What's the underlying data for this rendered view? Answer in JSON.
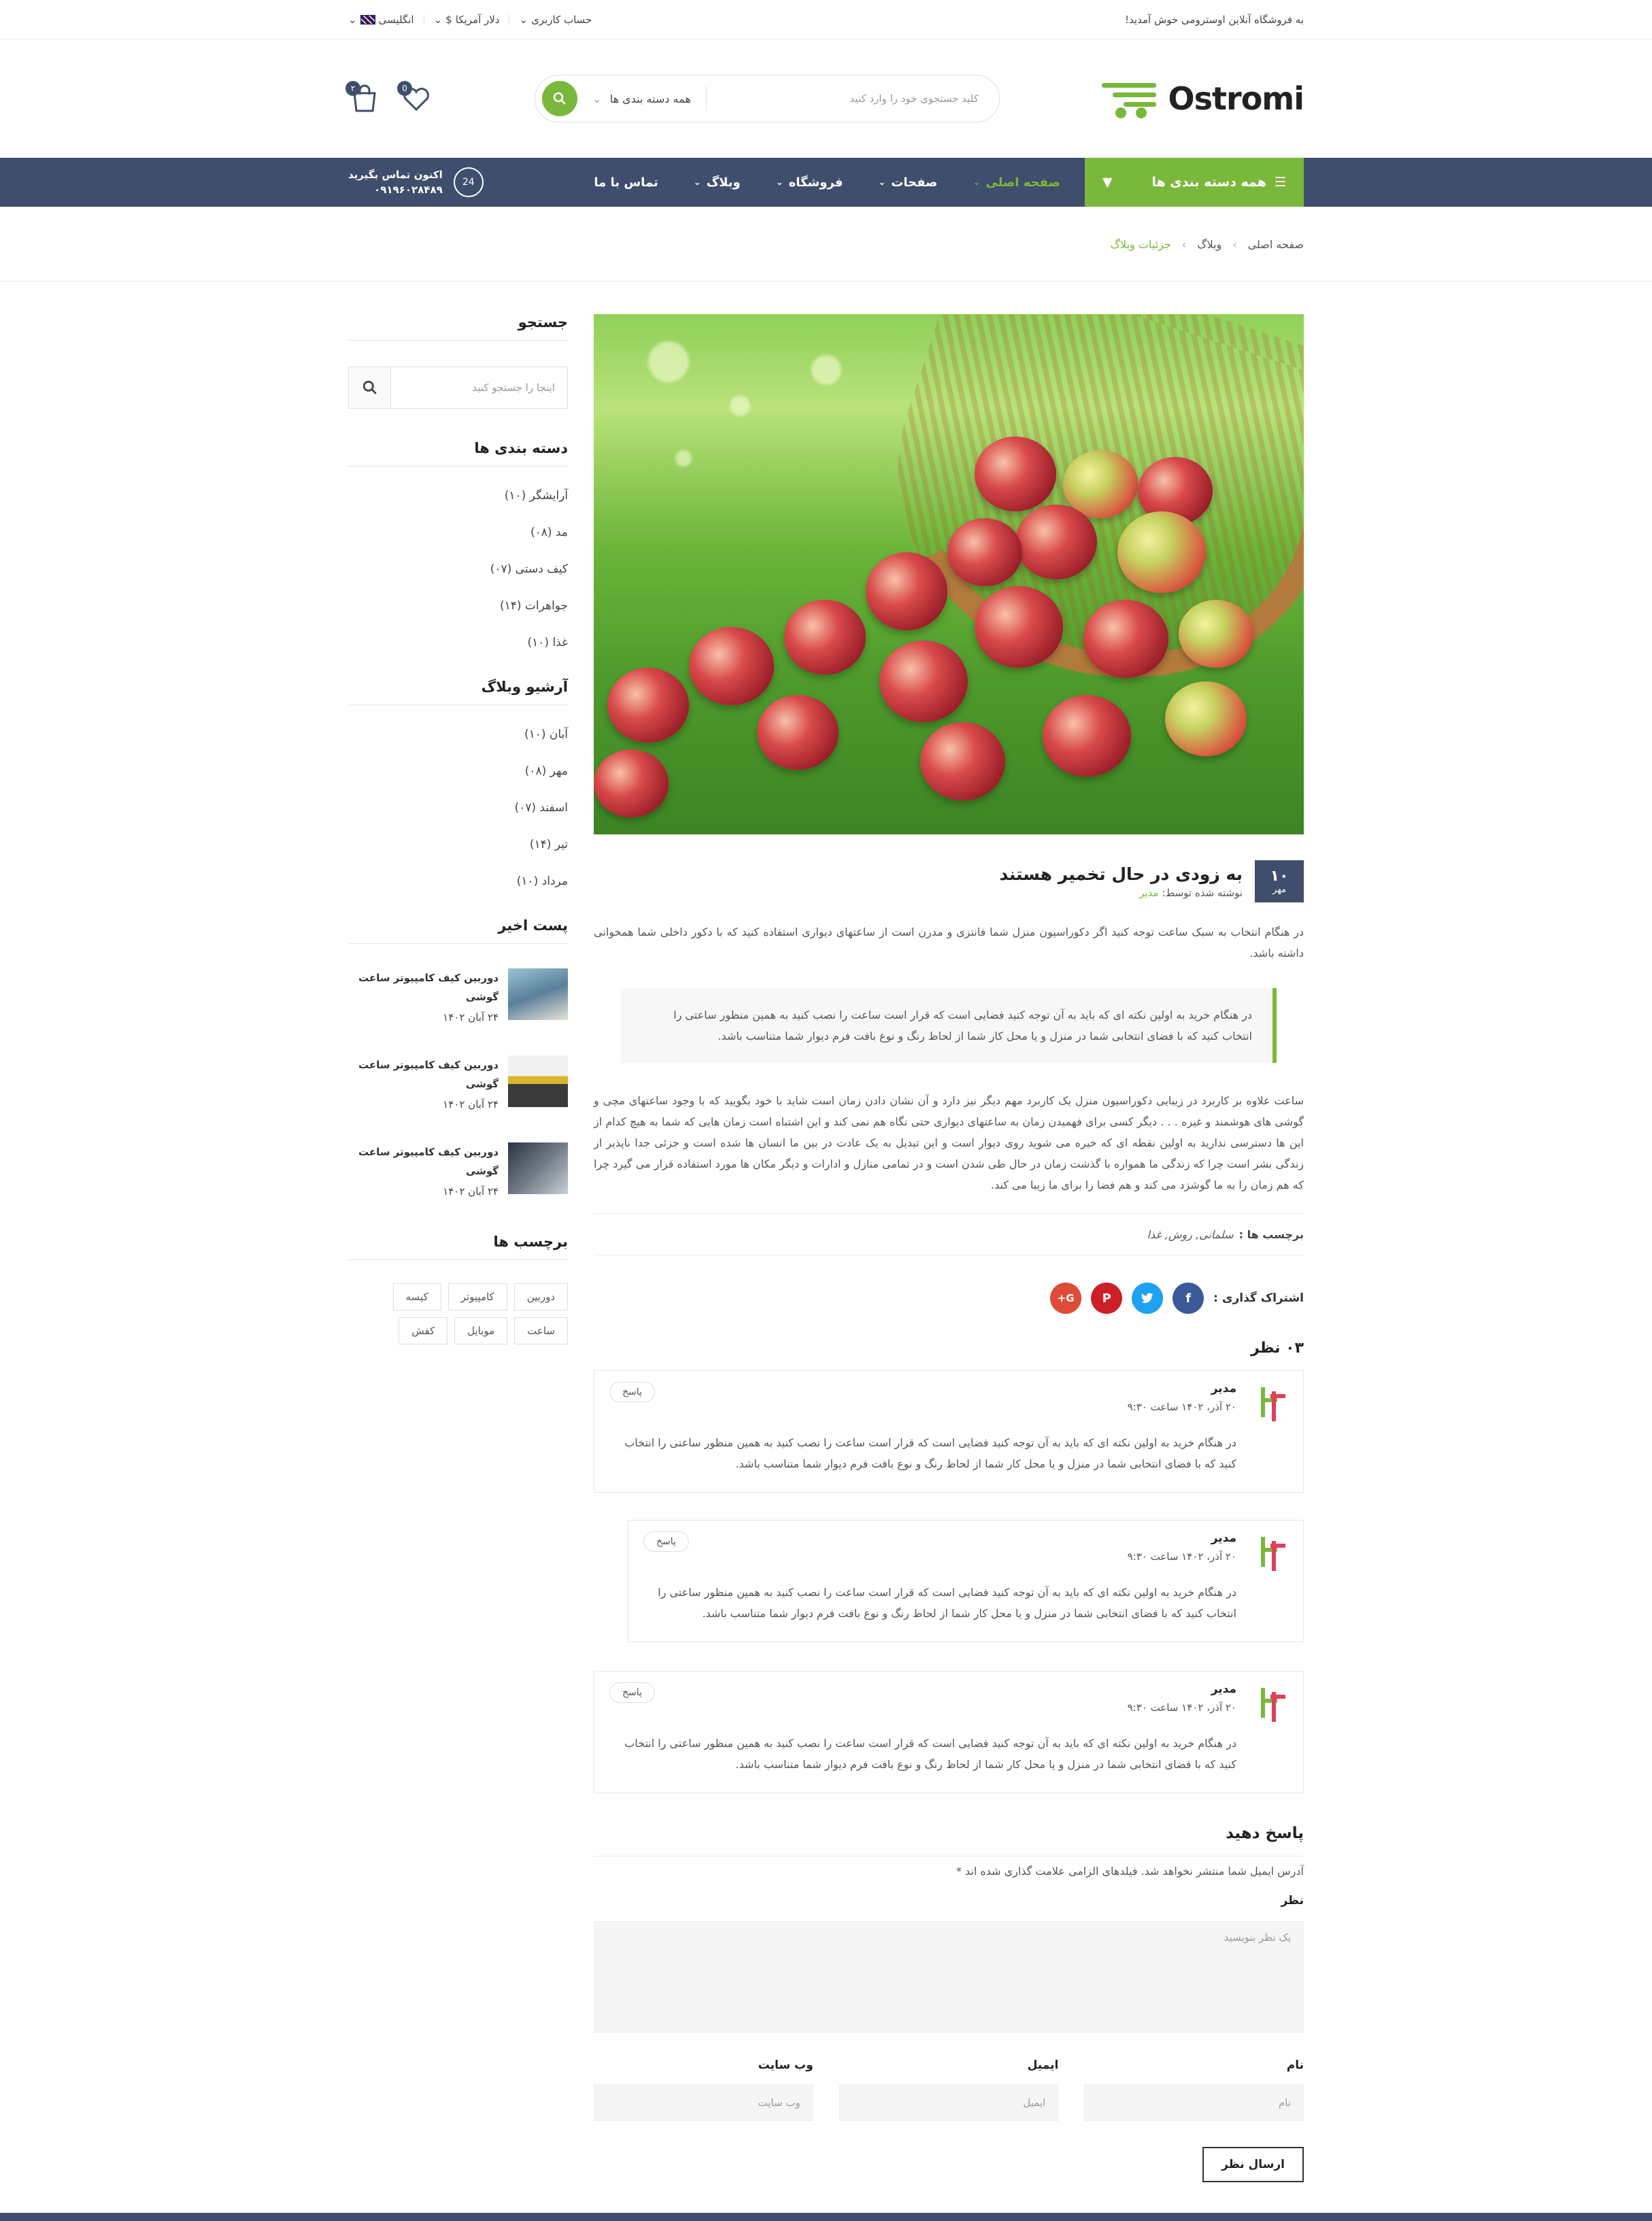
{
  "topbar": {
    "welcome": "به فروشگاه آنلاین اوسترومی خوش آمدید!",
    "account": "حساب کاربری",
    "currency": "دلار آمریکا",
    "currency_symbol": "$",
    "language": "انگلیسی"
  },
  "header": {
    "logo": "Ostromi",
    "search_placeholder": "کلید جستجوی خود را وارد کنید",
    "category": "همه دسته بندی ها",
    "wishlist_count": "0",
    "cart_count": "۲"
  },
  "nav": {
    "all_categories": "همه دسته بندی ها",
    "items": [
      {
        "label": "صفحه اصلی",
        "active": true
      },
      {
        "label": "صفحات"
      },
      {
        "label": "فروشگاه"
      },
      {
        "label": "وبلاگ"
      },
      {
        "label": "تماس با ما"
      }
    ],
    "contact_label": "اکنون تماس بگیرید",
    "phone": "۰۹۱۹۶۰۲۸۴۸۹",
    "support_badge": "24"
  },
  "breadcrumb": [
    "صفحه اصلی",
    "وبلاگ",
    "جزئیات وبلاگ"
  ],
  "post": {
    "day": "۱۰",
    "month": "مهر",
    "title": "به زودی در حال تخمیر هستند",
    "by_label": "نوشته شده توسط:",
    "author": "مدیر",
    "p1": "در هنگام انتخاب به سبک ساعت توجه کنید اگر دکوراسیون منزل شما فانتزی و مدرن است از ساعتهای دیواری استفاده کنید که با دکور داخلی شما همخوانی داشته باشد.",
    "quote": "در هنگام خرید به اولین نکته ای که باید به آن توجه کنید فضایی است که قرار است ساعت را نصب کنید به همین منظور ساعتی را انتخاب کنید که با فضای انتخابی شما در منزل و یا محل کار شما از لحاظ رنگ و نوع بافت فرم دیوار شما متناسب باشد.",
    "p2": "ساعت علاوه بر کاربرد در زیبایی دکوراسیون منزل یک کاربرد مهم دیگر نیز دارد و آن نشان دادن زمان است شاید با خود بگویید که با وجود ساعتهای مچی و گوشی های هوشمند و غیره . . . دیگر کسی برای فهمیدن زمان به ساعتهای دیواری حتی نگاه هم نمی کند و این اشتباه است زمان هایی که شما به هیچ کدام از این ها دسترسی ندارید به اولین نقطه ای که خیره می شوید روی دیوار است و این تبدیل به یک عادت در بین ما انسان ها شده است و جزئی جدا ناپذیر از زندگی بشر است چرا که زندگی ما همواره با گذشت زمان در حال طی شدن است و در تمامی منازل و ادارات و دیگر مکان ها مورد استفاده قرار می گیرد چرا که هم زمان را به ما گوشزد می کند و هم فضا را برای ما زیبا می کند.",
    "tags_label": "برچسب ها :",
    "tags_value": "سلمانی, روش, غذا",
    "share_label": "اشتراک گذاری :",
    "share_icons": [
      "facebook-icon",
      "twitter-icon",
      "pinterest-icon",
      "google-plus-icon"
    ]
  },
  "comments": {
    "count_label": "۰۳ نظر",
    "items": [
      {
        "name": "مدیر",
        "time": "۲۰ آذر، ۱۴۰۲ ساعت ۹:۳۰",
        "reply": "پاسخ",
        "text": "در هنگام خرید به اولین نکته ای که باید به آن توجه کنید فضایی است که قرار است ساعت را نصب کنید به همین منظور ساعتی را انتخاب کنید که با فضای انتخابی شما در منزل و یا محل کار شما از لحاظ رنگ و نوع بافت فرم دیوار شما متناسب باشد."
      },
      {
        "name": "مدیر",
        "time": "۲۰ آذر، ۱۴۰۲ ساعت ۹:۳۰",
        "reply": "پاسخ",
        "text": "در هنگام خرید به اولین نکته ای که باید به آن توجه کنید فضایی است که قرار است ساعت را نصب کنید به همین منظور ساعتی را انتخاب کنید که با فضای انتخابی شما در منزل و یا محل کار شما از لحاظ رنگ و نوع بافت فرم دیوار شما متناسب باشد."
      },
      {
        "name": "مدیر",
        "time": "۲۰ آذر، ۱۴۰۲ ساعت ۹:۳۰",
        "reply": "پاسخ",
        "text": "در هنگام خرید به اولین نکته ای که باید به آن توجه کنید فضایی است که قرار است ساعت را نصب کنید به همین منظور ساعتی را انتخاب کنید که با فضای انتخابی شما در منزل و یا محل کار شما از لحاظ رنگ و نوع بافت فرم دیوار شما متناسب باشد."
      }
    ]
  },
  "form": {
    "title": "پاسخ دهید",
    "note": "آدرس ایمیل شما منتشر نخواهد شد. فیلدهای الزامی علامت گذاری شده اند *",
    "comment_label": "نظر",
    "comment_placeholder": "یک نظر بنویسید",
    "name_label": "نام",
    "name_placeholder": "نام",
    "email_label": "ایمیل",
    "email_placeholder": "ایمیل",
    "website_label": "وب سایت",
    "website_placeholder": "وب سایت",
    "submit": "ارسال نظر"
  },
  "sidebar": {
    "search_title": "جستجو",
    "search_placeholder": "اینجا را جستجو کنید",
    "categories_title": "دسته بندی ها",
    "categories": [
      "آرایشگر (۱۰)",
      "مد (۰۸)",
      "کیف دستی (۰۷)",
      "جواهرات (۱۴)",
      "غذا (۱۰)"
    ],
    "archive_title": "آرشیو وبلاگ",
    "archive": [
      "آبان (۱۰)",
      "مهر (۰۸)",
      "اسفند (۰۷)",
      "تیر (۱۴)",
      "مرداد (۱۰)"
    ],
    "recent_title": "پست اخیر",
    "recent": [
      {
        "title": "دوربین کیف کامپیوتر ساعت گوشی",
        "date": "۲۴ آبان ۱۴۰۲"
      },
      {
        "title": "دوربین کیف کامپیوتر ساعت گوشی",
        "date": "۲۴ آبان ۱۴۰۲"
      },
      {
        "title": "دوربین کیف کامپیوتر ساعت گوشی",
        "date": "۲۴ آبان ۱۴۰۲"
      }
    ],
    "tags_title": "برچسب ها",
    "tags": [
      "دوربین",
      "کامپیوتر",
      "کیسه",
      "ساعت",
      "موبایل",
      "کفش"
    ]
  },
  "colors": {
    "accent": "#7ab83b",
    "navy": "#3e4e6c"
  }
}
